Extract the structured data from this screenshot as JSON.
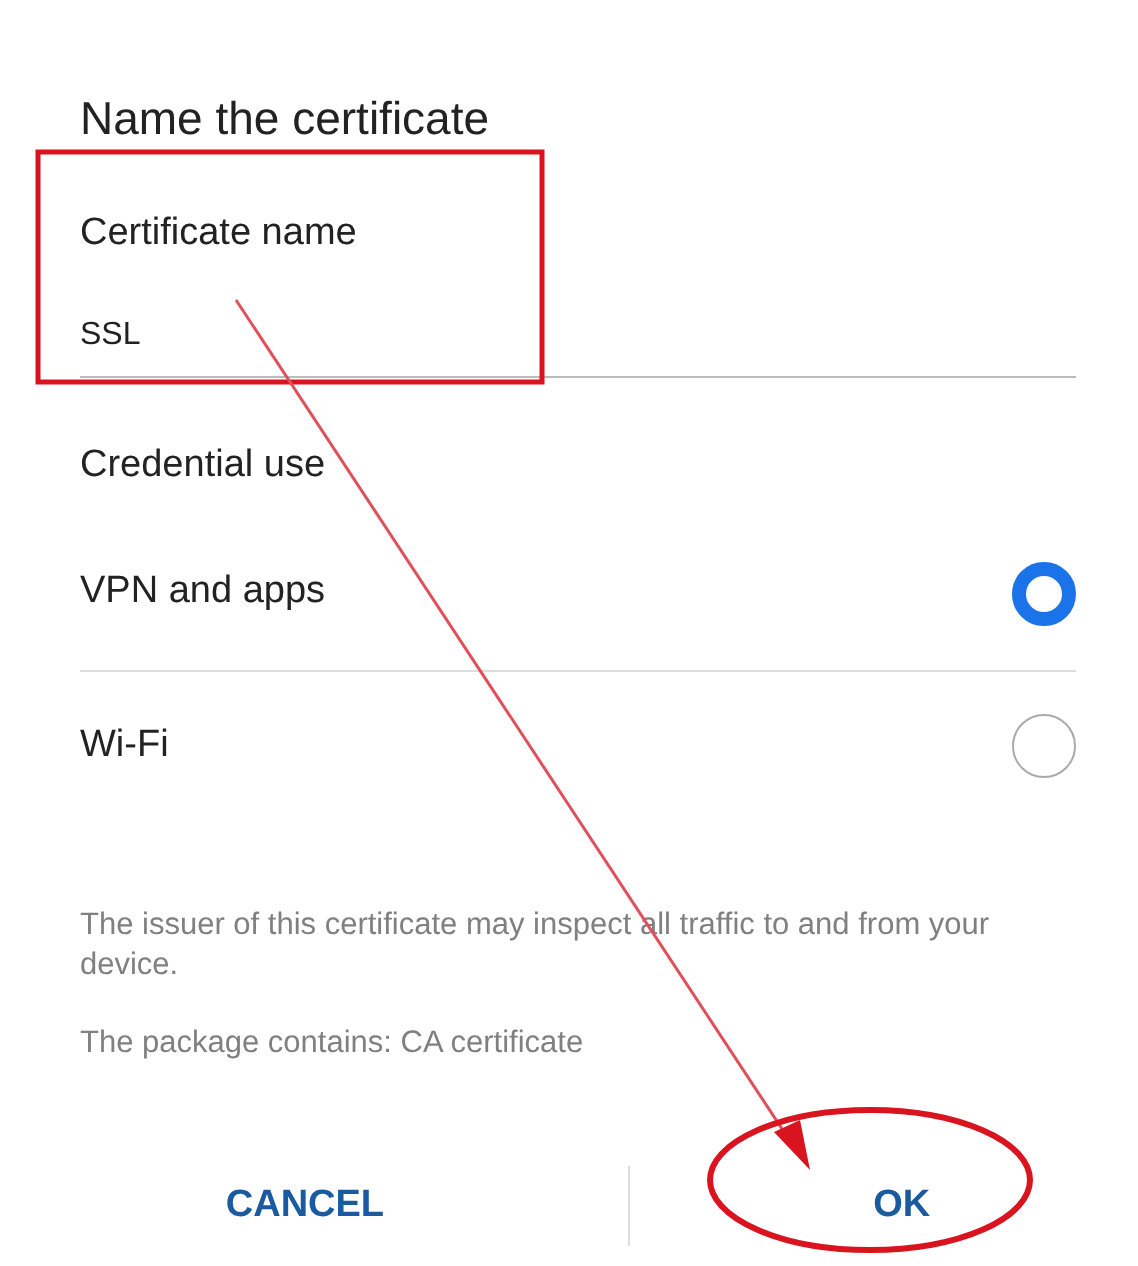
{
  "dialog": {
    "title": "Name the certificate",
    "field": {
      "label": "Certificate name",
      "value": "SSL"
    },
    "section_label": "Credential use",
    "options": [
      {
        "label": "VPN and apps",
        "selected": true
      },
      {
        "label": "Wi-Fi",
        "selected": false
      }
    ],
    "notes": [
      "The issuer of this certificate may inspect all traffic to and from your device.",
      "The package contains: CA certificate"
    ],
    "buttons": [
      "CANCEL",
      "OK"
    ]
  },
  "annotations": [
    {
      "kind": "box"
    },
    {
      "kind": "arrow"
    },
    {
      "kind": "ellipse"
    }
  ]
}
